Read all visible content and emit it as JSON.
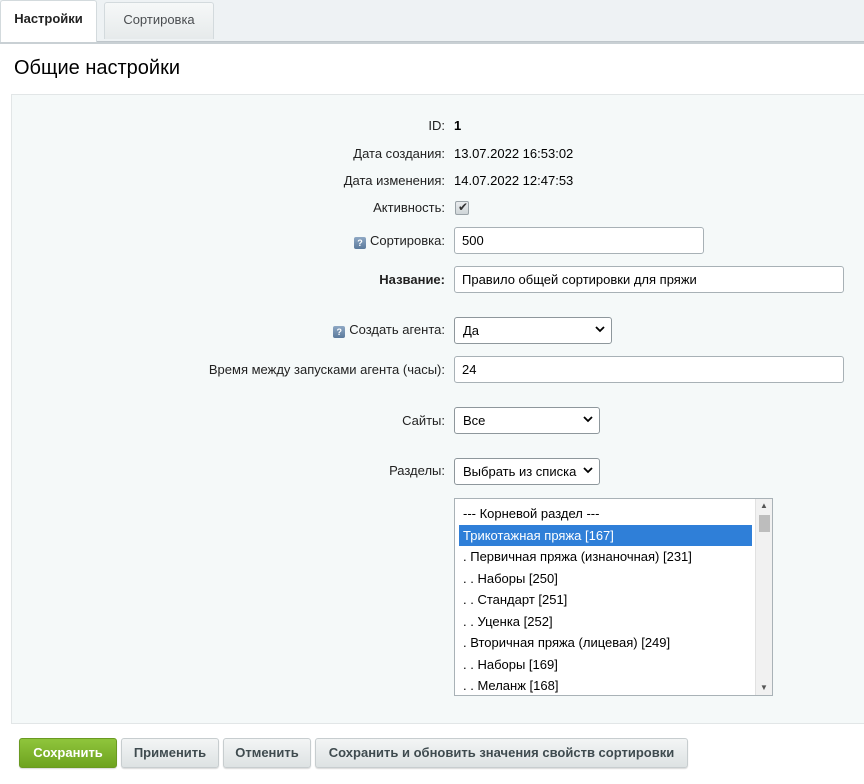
{
  "tabs": [
    {
      "label": "Настройки",
      "active": true
    },
    {
      "label": "Сортировка",
      "active": false
    }
  ],
  "section_title": "Общие настройки",
  "fields": {
    "id_label": "ID:",
    "id_value": "1",
    "created_label": "Дата создания:",
    "created_value": "13.07.2022 16:53:02",
    "modified_label": "Дата изменения:",
    "modified_value": "14.07.2022 12:47:53",
    "active_label": "Активность:",
    "active_checked": true,
    "sort_label": "Сортировка:",
    "sort_value": "500",
    "name_label": "Название:",
    "name_value": "Правило общей сортировки для пряжи",
    "agent_label": "Создать агента:",
    "agent_value": "Да",
    "interval_label": "Время между запусками агента (часы):",
    "interval_value": "24",
    "sites_label": "Сайты:",
    "sites_value": "Все",
    "sections_label": "Разделы:",
    "sections_value": "Выбрать из списка"
  },
  "sections_list": {
    "items": [
      {
        "label": "--- Корневой раздел ---",
        "selected": false
      },
      {
        "label": "Трикотажная пряжа [167]",
        "selected": true
      },
      {
        "label": ". Первичная пряжа (изнаночная) [231]",
        "selected": false
      },
      {
        "label": ". . Наборы [250]",
        "selected": false
      },
      {
        "label": ". . Стандарт [251]",
        "selected": false
      },
      {
        "label": ". . Уценка [252]",
        "selected": false
      },
      {
        "label": ". Вторичная пряжа (лицевая) [249]",
        "selected": false
      },
      {
        "label": ". . Наборы [169]",
        "selected": false
      },
      {
        "label": ". . Меланж [168]",
        "selected": false
      }
    ]
  },
  "buttons": {
    "save": "Сохранить",
    "apply": "Применить",
    "cancel": "Отменить",
    "save_update": "Сохранить и обновить значения свойств сортировки"
  },
  "colors": {
    "primary_button": "#7bb32e",
    "selected_item": "#2f7fd8",
    "panel_bg": "#f5f9f9"
  },
  "icons": {
    "hint": "question-hint-icon",
    "checkbox": "checkmark-icon",
    "select": "chevron-down-icon"
  }
}
